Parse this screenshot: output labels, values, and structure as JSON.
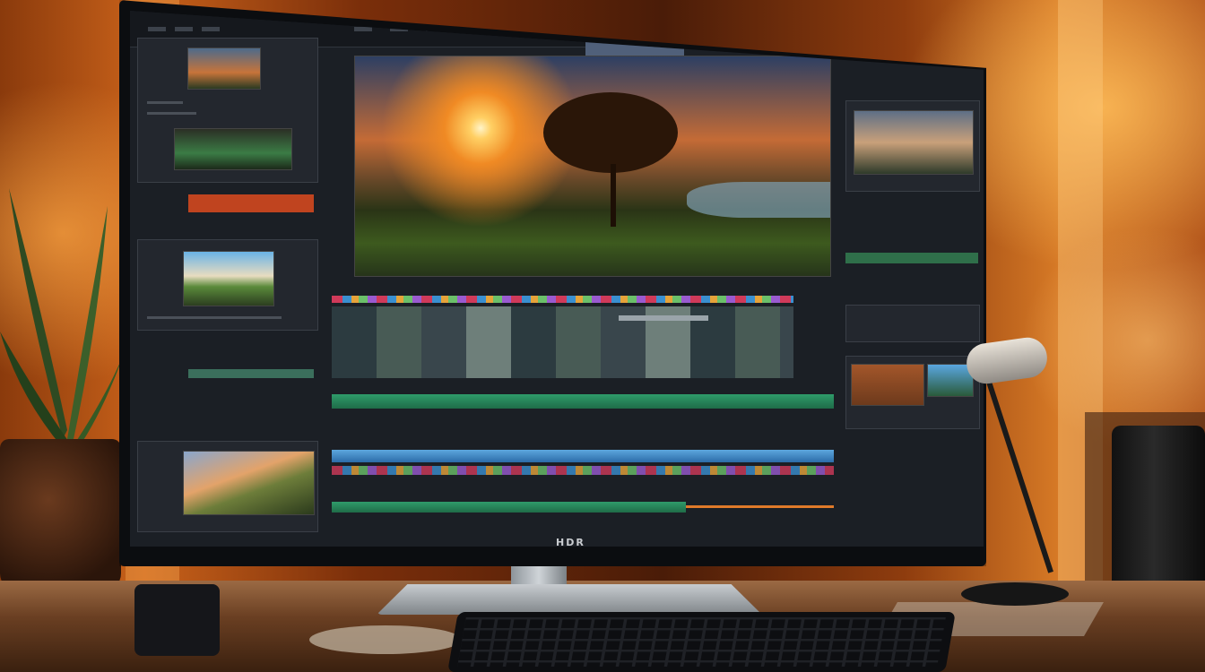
{
  "monitor": {
    "logo_text": "HDR",
    "app": "video-editor"
  },
  "colors": {
    "background": "#8a3a0c",
    "screen": "#1b1f25",
    "track_green": "#2f9b6a",
    "track_blue": "#5da7de",
    "accent_red": "#c0441f",
    "accent_orange": "#e07a2a"
  },
  "icons": [
    "plant-icon",
    "lamp-icon",
    "keyboard-icon"
  ]
}
